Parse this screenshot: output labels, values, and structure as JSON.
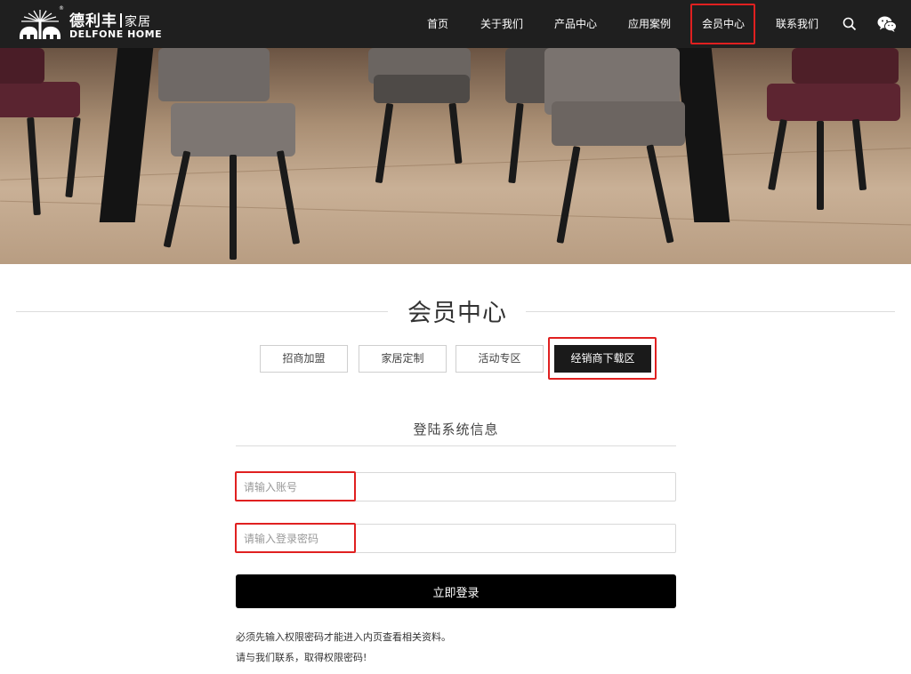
{
  "brand": {
    "cn": "德利丰",
    "home_cn": "家居",
    "en": "DELFONE HOME",
    "reg": "®"
  },
  "nav": {
    "items": [
      "首页",
      "关于我们",
      "产品中心",
      "应用案例",
      "会员中心",
      "联系我们"
    ],
    "active": "会员中心",
    "icons": [
      "search-icon",
      "wechat-icon"
    ]
  },
  "section": {
    "title": "会员中心",
    "tabs": [
      "招商加盟",
      "家居定制",
      "活动专区",
      "经销商下载区"
    ],
    "active_tab": "经销商下载区"
  },
  "login": {
    "title": "登陆系统信息",
    "account_placeholder": "请输入账号",
    "password_placeholder": "请输入登录密码",
    "submit_label": "立即登录",
    "note_1": "必须先输入权限密码才能进入内页查看相关资料。",
    "note_2": "请与我们联系，取得权限密码!"
  },
  "colors": {
    "topbar": "#1f1f1f",
    "highlight": "#e02020",
    "active_tab": "#1a1a1a",
    "submit": "#000000"
  }
}
